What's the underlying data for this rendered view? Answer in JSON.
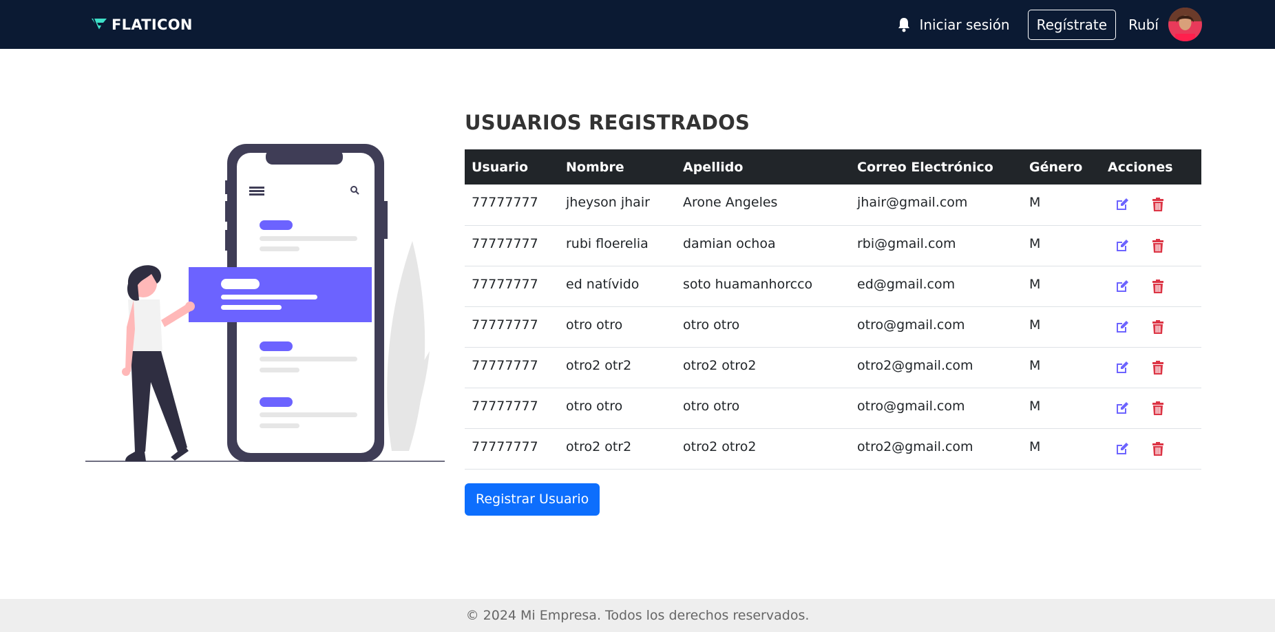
{
  "nav": {
    "brand": "FLATICON",
    "login_label": "Iniciar sesión",
    "register_label": "Regístrate",
    "user_name": "Rubí"
  },
  "main": {
    "title": "USUARIOS REGISTRADOS",
    "columns": [
      "Usuario",
      "Nombre",
      "Apellido",
      "Correo Electrónico",
      "Género",
      "Acciones"
    ],
    "rows": [
      [
        "77777777",
        "jheyson jhair",
        "Arone Angeles",
        "jhair@gmail.com",
        "M"
      ],
      [
        "77777777",
        "rubi floerelia",
        "damian ochoa",
        "rbi@gmail.com",
        "M"
      ],
      [
        "77777777",
        "ed natívido",
        "soto huamanhorcco",
        "ed@gmail.com",
        "M"
      ],
      [
        "77777777",
        "otro otro",
        "otro otro",
        "otro@gmail.com",
        "M"
      ],
      [
        "77777777",
        "otro2 otr2",
        "otro2 otro2",
        "otro2@gmail.com",
        "M"
      ],
      [
        "77777777",
        "otro otro",
        "otro otro",
        "otro@gmail.com",
        "M"
      ],
      [
        "77777777",
        "otro2 otr2",
        "otro2 otro2",
        "otro2@gmail.com",
        "M"
      ]
    ],
    "register_button": "Registrar Usuario"
  },
  "footer": {
    "text": "© 2024 Mi Empresa. Todos los derechos reservados."
  },
  "icons": {
    "edit": "edit-icon",
    "delete": "trash-icon",
    "bell": "bell-icon"
  },
  "colors": {
    "navbar": "#0b1a33",
    "accent_purple": "#6c63ff",
    "delete_red": "#dc3545",
    "primary_blue": "#0d6efd",
    "table_header": "#212529"
  }
}
